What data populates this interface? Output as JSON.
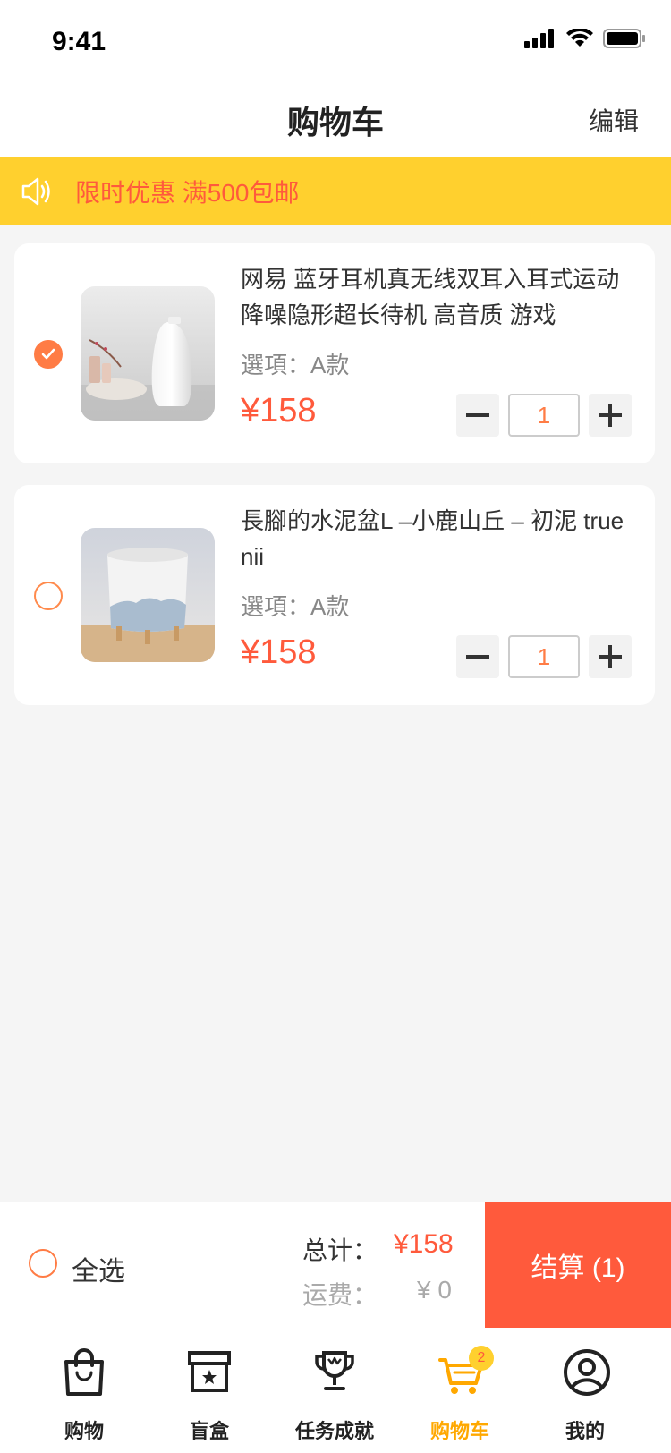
{
  "status": {
    "time": "9:41"
  },
  "nav": {
    "title": "购物车",
    "edit": "编辑"
  },
  "promo": {
    "text": "限时优惠 满500包邮",
    "icon": "speaker-icon"
  },
  "items": [
    {
      "title": "网易 蓝牙耳机真无线双耳入耳式运动降噪隐形超长待机 高音质 游戏",
      "option": "選項：A款",
      "price": "¥158",
      "qty": "1",
      "checked": true
    },
    {
      "title": "長腳的水泥盆L –小鹿山丘 – 初泥 true nii",
      "option": "選項：A款",
      "price": "¥158",
      "qty": "1",
      "checked": false
    }
  ],
  "summary": {
    "select_all": "全选",
    "total_label": "总计：",
    "total_value": "¥158",
    "shipping_label": "运费：",
    "shipping_value": "¥ 0",
    "checkout": "结算 (1)"
  },
  "tabs": [
    {
      "label": "购物",
      "icon": "shopping-bag-icon"
    },
    {
      "label": "盲盒",
      "icon": "blind-box-icon"
    },
    {
      "label": "任务成就",
      "icon": "trophy-icon"
    },
    {
      "label": "购物车",
      "icon": "cart-icon",
      "badge": "2",
      "active": true
    },
    {
      "label": "我的",
      "icon": "profile-icon"
    }
  ],
  "colors": {
    "accent": "#ff5a3c",
    "orange": "#ff7c45",
    "yellow": "#ffd02e",
    "tab_active": "#ffa800"
  }
}
